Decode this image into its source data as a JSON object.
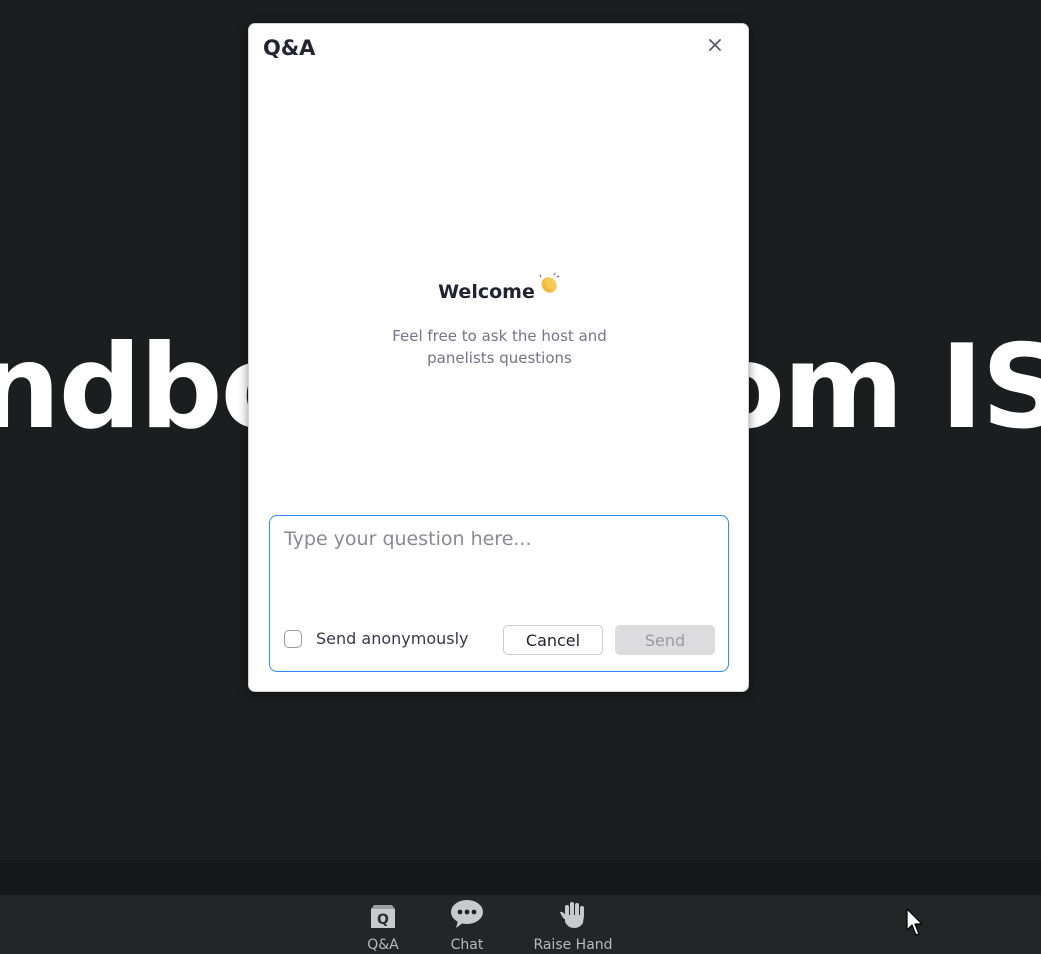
{
  "background": {
    "left_text": "ndbo",
    "right_text": "om IS"
  },
  "dialog": {
    "title": "Q&A",
    "close_icon": "close-icon",
    "welcome": {
      "title": "Welcome",
      "emoji_icon": "clapping-hands-icon",
      "subtitle": "Feel free to ask the host and panelists questions"
    },
    "compose": {
      "placeholder": "Type your question here...",
      "value": "",
      "anonymous_label": "Send anonymously",
      "anonymous_checked": false,
      "cancel_label": "Cancel",
      "send_label": "Send",
      "send_enabled": false
    }
  },
  "toolbar": {
    "items": [
      {
        "label": "Q&A",
        "icon": "qa-icon"
      },
      {
        "label": "Chat",
        "icon": "chat-bubble-icon"
      },
      {
        "label": "Raise Hand",
        "icon": "raise-hand-icon"
      }
    ]
  },
  "colors": {
    "accent": "#2d8cff",
    "background": "#1c1d1f",
    "toolbar": "#242527"
  }
}
